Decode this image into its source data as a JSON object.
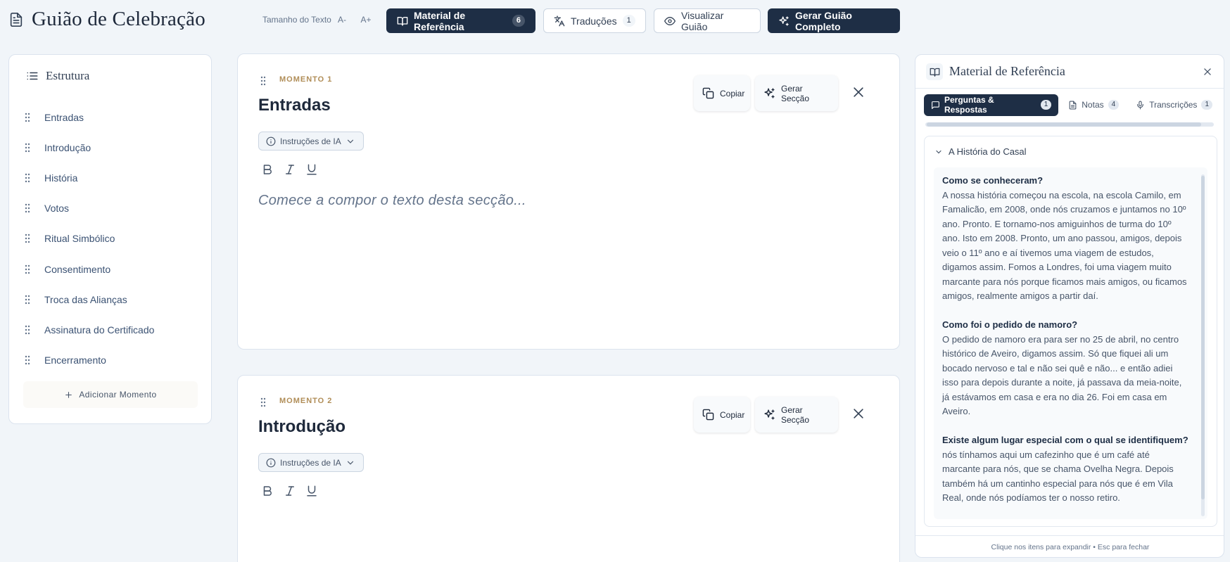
{
  "header": {
    "title": "Guião de Celebração",
    "text_size_label": "Tamanho do Texto",
    "text_size_minus": "A-",
    "text_size_plus": "A+",
    "reference_button": {
      "label": "Material de Referência",
      "count": "6"
    },
    "translations_button": {
      "label": "Traduções",
      "count": "1"
    },
    "preview_button": {
      "label": "Visualizar Guião"
    },
    "generate_button": {
      "label": "Gerar Guião Completo"
    }
  },
  "sidebar": {
    "title": "Estrutura",
    "items": [
      {
        "label": "Entradas"
      },
      {
        "label": "Introdução"
      },
      {
        "label": "História"
      },
      {
        "label": "Votos"
      },
      {
        "label": "Ritual Simbólico"
      },
      {
        "label": "Consentimento"
      },
      {
        "label": "Troca das Alianças"
      },
      {
        "label": "Assinatura do Certificado"
      },
      {
        "label": "Encerramento"
      }
    ],
    "add_moment_label": "Adicionar Momento"
  },
  "moments": [
    {
      "label": "MOMENTO 1",
      "title": "Entradas",
      "ai_instructions_label": "Instruções de IA",
      "copy_label": "Copiar",
      "generate_label": "Gerar Secção",
      "placeholder": "Comece a compor o texto desta secção..."
    },
    {
      "label": "MOMENTO 2",
      "title": "Introdução",
      "ai_instructions_label": "Instruções de IA",
      "copy_label": "Copiar",
      "generate_label": "Gerar Secção"
    }
  ],
  "panel": {
    "title": "Material de Referência",
    "tabs": [
      {
        "label": "Perguntas & Respostas",
        "count": "1",
        "icon": "message-icon",
        "active": true
      },
      {
        "label": "Notas",
        "count": "4",
        "icon": "file-icon",
        "active": false
      },
      {
        "label": "Transcrições",
        "count": "1",
        "icon": "mic-icon",
        "active": false
      }
    ],
    "section_title": "A História do Casal",
    "qa": [
      {
        "question": "Como se conheceram?",
        "answer": "A nossa história começou na escola, na escola Camilo, em Famalicão, em 2008, onde nós cruzamos e juntamos no 10º ano. Pronto. E tornamo-nos amiguinhos de turma do 10º ano. Isto em 2008. Pronto, um ano passou, amigos, depois veio o 11º ano e aí tivemos uma viagem de estudos, digamos assim. Fomos a Londres, foi uma viagem muito marcante para nós porque ficamos mais amigos, ou ficamos amigos, realmente amigos a partir daí."
      },
      {
        "question": "Como foi o pedido de namoro?",
        "answer": "O pedido de namoro era para ser no 25 de abril, no centro histórico de Aveiro, digamos assim. Só que fiquei ali um bocado nervoso e tal e não sei quê e não... e então adiei isso para depois durante a noite, já passava da meia-noite, já estávamos em casa e era no dia 26. Foi em casa em Aveiro."
      },
      {
        "question": "Existe algum lugar especial com o qual se identifiquem?",
        "answer": "nós tínhamos aqui um cafezinho que é um café até marcante para nós, que se chama Ovelha Negra. Depois também há um cantinho especial para nós que é em Vila Real, onde nós podíamos ter o nosso retiro."
      }
    ],
    "footer_hint": "Clique nos itens para expandir • Esc para fechar"
  },
  "colors": {
    "accent_dark": "#1e2e45",
    "moment_label": "#b08d57",
    "background": "#f1f5f9"
  }
}
